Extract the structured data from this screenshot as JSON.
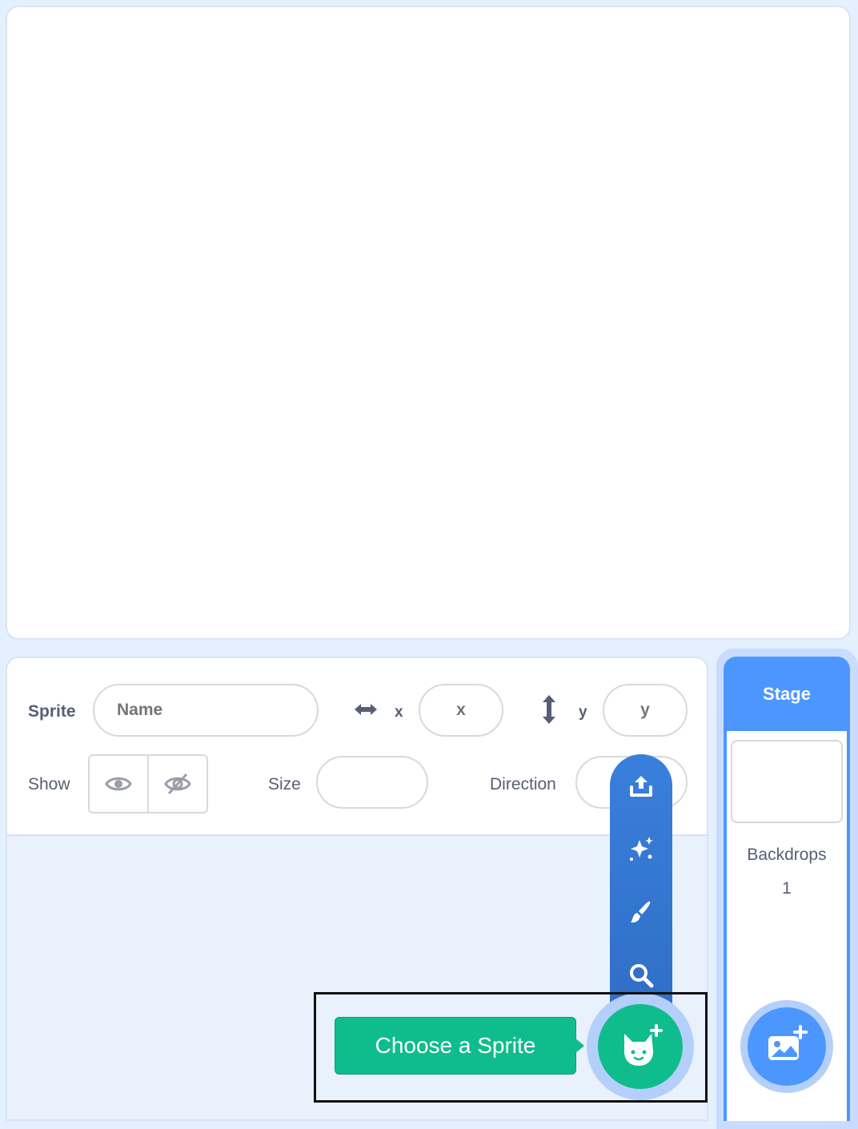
{
  "sprite_info": {
    "sprite_label": "Sprite",
    "name_placeholder": "Name",
    "x_label": "x",
    "x_placeholder": "x",
    "y_label": "y",
    "y_placeholder": "y",
    "show_label": "Show",
    "size_label": "Size",
    "direction_label": "Direction"
  },
  "sprite_menu": {
    "items": [
      "upload-icon",
      "surprise-icon",
      "paint-icon",
      "search-icon"
    ],
    "tooltip": "Choose a Sprite",
    "button_icon": "cat-icon"
  },
  "stage_selector": {
    "header": "Stage",
    "backdrops_label": "Backdrops",
    "backdrops_count": "1",
    "button_icon": "add-backdrop-icon"
  },
  "colors": {
    "accent_blue": "#4c97ff",
    "flyout_blue": "#3a7fdc",
    "sprite_green": "#0fbd8c",
    "text": "#575e75",
    "background": "#e5f0ff"
  }
}
